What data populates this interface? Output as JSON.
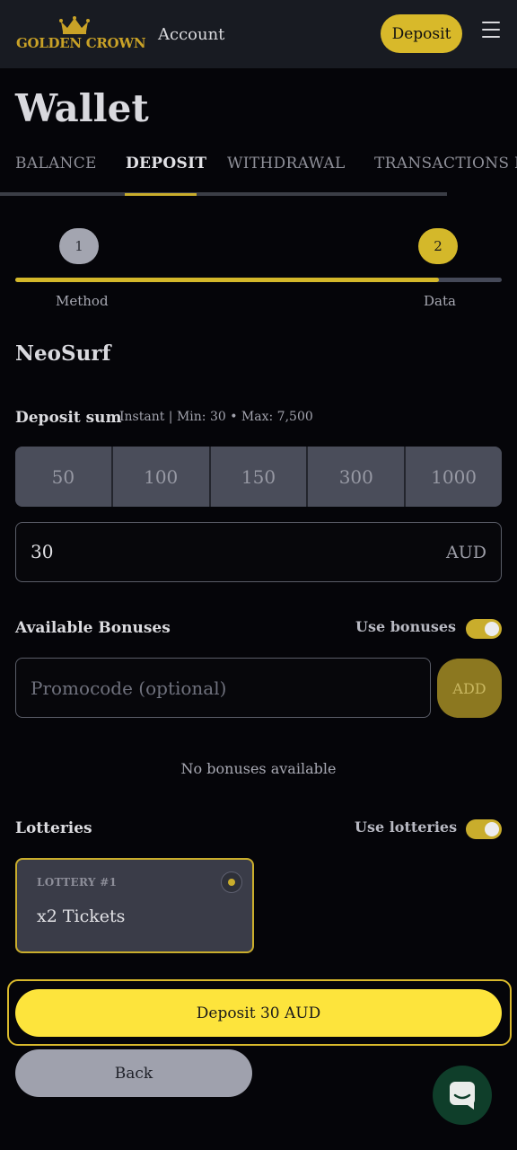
{
  "header": {
    "logo_text": "GOLDEN CROWN",
    "account_label": "Account",
    "deposit_label": "Deposit"
  },
  "wallet": {
    "title": "Wallet",
    "tabs": [
      {
        "label": "BALANCE",
        "active": false
      },
      {
        "label": "DEPOSIT",
        "active": true
      },
      {
        "label": "WITHDRAWAL",
        "active": false
      },
      {
        "label": "TRANSACTIONS H",
        "active": false
      }
    ]
  },
  "steps": {
    "items": [
      {
        "number": "1",
        "label": "Method"
      },
      {
        "number": "2",
        "label": "Data"
      }
    ],
    "progress": 0.87
  },
  "method": {
    "name": "NeoSurf"
  },
  "deposit_sum": {
    "label": "Deposit sum",
    "info": "Instant | Min: 30 • Max: 7,500",
    "presets": [
      "50",
      "100",
      "150",
      "300",
      "1000"
    ],
    "value": "30",
    "currency": "AUD"
  },
  "bonuses": {
    "title": "Available Bonuses",
    "toggle_label": "Use bonuses",
    "toggle_on": true,
    "promo_placeholder": "Promocode (optional)",
    "add_label": "ADD",
    "empty_text": "No bonuses available"
  },
  "lotteries": {
    "title": "Lotteries",
    "toggle_label": "Use lotteries",
    "toggle_on": true,
    "cards": [
      {
        "label": "LOTTERY #1",
        "value": "x2 Tickets",
        "selected": true
      }
    ]
  },
  "actions": {
    "deposit_label": "Deposit 30 AUD",
    "back_label": "Back"
  },
  "colors": {
    "accent": "#d4b82a",
    "deposit_button": "#fde43c",
    "background": "#050509",
    "chat_button": "#0f3e2a"
  },
  "icons": {
    "logo": "crown-icon",
    "menu": "hamburger-menu-icon",
    "chat": "chat-icon"
  }
}
